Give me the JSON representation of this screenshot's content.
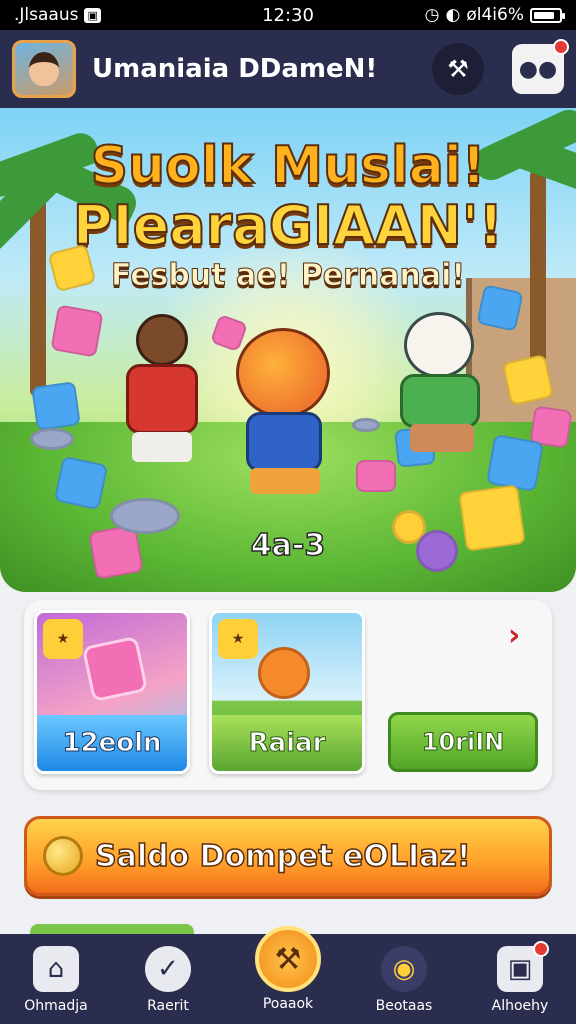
{
  "status_bar": {
    "carrier": ".Jlsaaus",
    "time": "12:30",
    "signal_text": "øl4i6%",
    "battery_level": 0.85
  },
  "header": {
    "title": "Umaniaia DDameN!"
  },
  "banner": {
    "title_line1": "Suolk Muslai!",
    "title_line2": "PIearaGIAAN'!",
    "subtitle": "Fesbut ae! Pernanai!",
    "code": "4a-3"
  },
  "cards": {
    "tile1_label": "12eoln",
    "tile2_label": "Raiar",
    "side_button_label": "10riIN",
    "next_icon": "chevron-right-icon"
  },
  "wallet": {
    "label": "Saldo Dompet eOLIaz!"
  },
  "bottom_nav": [
    {
      "label": "Ohmadja",
      "icon": "home-icon"
    },
    {
      "label": "Raerit",
      "icon": "ticket-icon"
    },
    {
      "label": "Poaaok",
      "icon": "hammer-icon"
    },
    {
      "label": "Beotaas",
      "icon": "game-icon"
    },
    {
      "label": "Alhoehy",
      "icon": "camera-icon"
    }
  ],
  "colors": {
    "header_bg": "#2b2d4e",
    "accent_orange": "#ff9f2a",
    "accent_green": "#52a528",
    "badge_red": "#e53935"
  }
}
